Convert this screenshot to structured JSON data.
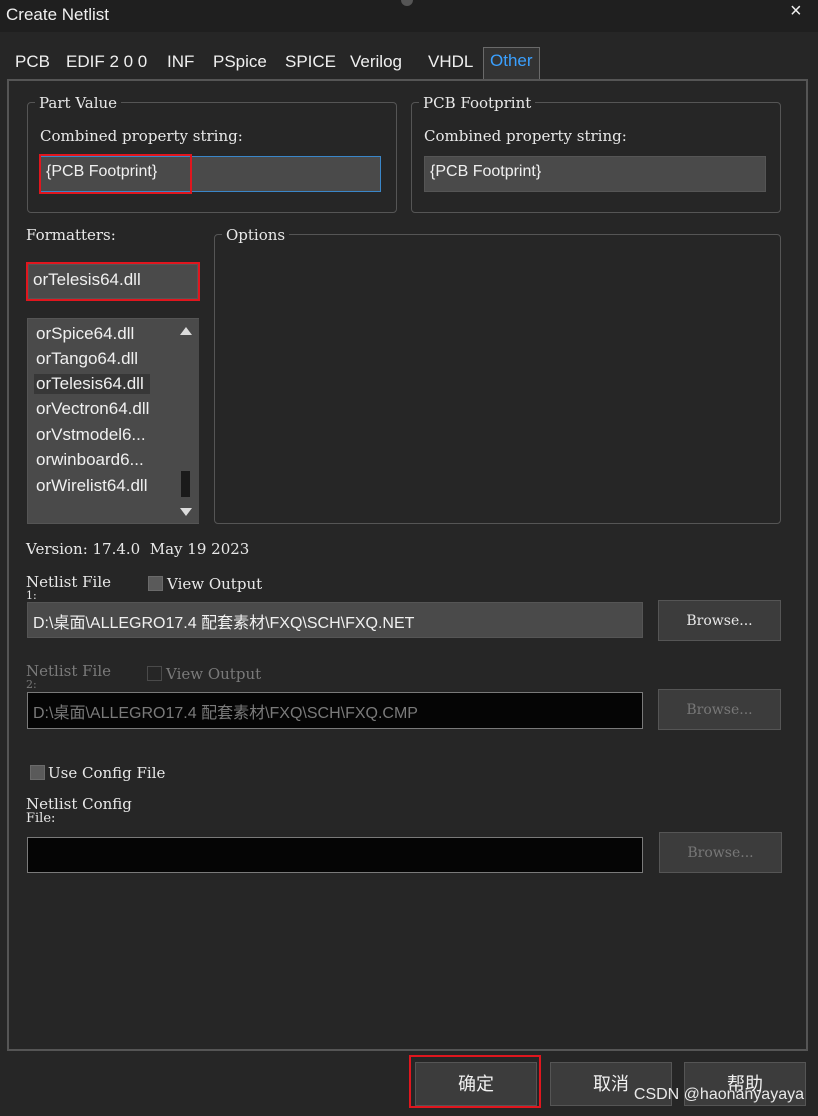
{
  "window": {
    "title": "Create Netlist",
    "close_glyph": "×"
  },
  "tabs": [
    {
      "label": "PCB"
    },
    {
      "label": "EDIF 2 0 0"
    },
    {
      "label": "INF"
    },
    {
      "label": "PSpice"
    },
    {
      "label": "SPICE"
    },
    {
      "label": "Verilog"
    },
    {
      "label": "VHDL"
    },
    {
      "label": "Other",
      "active": true
    }
  ],
  "part_value": {
    "legend": "Part Value",
    "label": "Combined property string:",
    "value": "{PCB Footprint}"
  },
  "pcb_footprint": {
    "legend": "PCB Footprint",
    "label": "Combined property string:",
    "value": "{PCB Footprint}"
  },
  "formatters": {
    "label": "Formatters:",
    "selected": "orTelesis64.dll",
    "items": [
      "orSpice64.dll",
      "orTango64.dll",
      "orTelesis64.dll",
      "orVectron64.dll",
      "orVstmodel6...",
      "orwinboard6...",
      "orWirelist64.dll"
    ]
  },
  "options": {
    "legend": "Options"
  },
  "version": "Version: 17.4.0  May 19 2023",
  "netlist1": {
    "label_line1": "Netlist File",
    "label_line2": "1:",
    "view_output": "View Output",
    "path": "D:\\桌面\\ALLEGRO17.4 配套素材\\FXQ\\SCH\\FXQ.NET",
    "browse": "Browse..."
  },
  "netlist2": {
    "label_line1": "Netlist File",
    "label_line2": "2:",
    "view_output": "View Output",
    "path": "D:\\桌面\\ALLEGRO17.4 配套素材\\FXQ\\SCH\\FXQ.CMP",
    "browse": "Browse..."
  },
  "config": {
    "use_label": "Use Config File",
    "label_line1": "Netlist Config",
    "label_line2": "File:",
    "path": "",
    "browse": "Browse..."
  },
  "buttons": {
    "ok": "确定",
    "cancel": "取消",
    "help": "帮助"
  },
  "watermark": "CSDN @haonanyayaya",
  "colors": {
    "accent": "#3aa0ff",
    "highlight": "#e0161e",
    "background": "#262626"
  }
}
